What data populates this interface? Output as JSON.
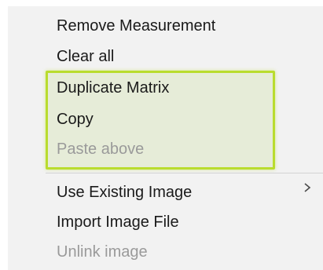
{
  "context_menu": {
    "items": [
      {
        "label": "Remove Measurement",
        "enabled": true
      },
      {
        "label": "Clear all",
        "enabled": true
      },
      {
        "label": "Duplicate Matrix",
        "enabled": true
      },
      {
        "label": "Copy",
        "enabled": true
      },
      {
        "label": "Paste above",
        "enabled": false
      },
      {
        "label": "Use Existing Image",
        "enabled": true,
        "submenu_icon": "chevron-right-icon"
      },
      {
        "label": "Import Image File",
        "enabled": true
      },
      {
        "label": "Unlink image",
        "enabled": false
      }
    ],
    "highlight_color": "#b9dc2e",
    "background_color": "#f2f2f2",
    "disabled_color": "#9a9a9a"
  }
}
